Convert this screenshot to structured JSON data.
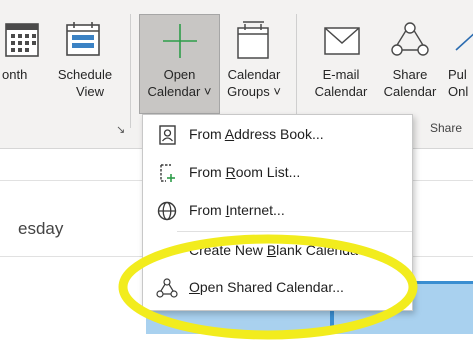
{
  "ribbon": {
    "buttons": {
      "month": {
        "label_line1": "onth"
      },
      "schedule": {
        "label_line1": "Schedule",
        "label_line2": "View"
      },
      "open_calendar": {
        "label_line1": "Open",
        "label_line2": "Calendar ˅"
      },
      "calendar_groups": {
        "label_line1": "Calendar",
        "label_line2": "Groups ˅"
      },
      "email_calendar": {
        "label_line1": "E-mail",
        "label_line2": "Calendar"
      },
      "share_calendar": {
        "label_line1": "Share",
        "label_line2": "Calendar"
      },
      "publish_online": {
        "label_line1": "Pul",
        "label_line2": "Onl"
      }
    },
    "group_label_share": "Share",
    "launcher_glyph": "↘"
  },
  "calendar": {
    "day_label": "esday"
  },
  "menu": {
    "items": [
      {
        "id": "address-book",
        "pre": "From ",
        "ul": "A",
        "post": "ddress Book..."
      },
      {
        "id": "room-list",
        "pre": "From ",
        "ul": "R",
        "post": "oom List..."
      },
      {
        "id": "internet",
        "pre": "From ",
        "ul": "I",
        "post": "nternet..."
      },
      {
        "id": "new-blank",
        "pre": "Create New ",
        "ul": "B",
        "post": "lank Calenda"
      },
      {
        "id": "shared",
        "pre": "",
        "ul": "O",
        "post": "pen Shared Calendar..."
      }
    ]
  },
  "colors": {
    "ribbon_bg": "#f3f2f1",
    "pressed_bg": "#c8c6c4",
    "accent_blue": "#2b579a",
    "icon_green": "#2e9d4a",
    "event_fill": "#a9d1ef",
    "event_border": "#3a8ed1",
    "highlight_yellow": "#f2ec1d"
  },
  "icons": [
    "month-view-icon",
    "schedule-view-icon",
    "plus-icon",
    "calendar-groups-icon",
    "envelope-icon",
    "share-people-icon",
    "address-book-icon",
    "room-list-icon",
    "globe-icon",
    "shared-people-icon"
  ]
}
